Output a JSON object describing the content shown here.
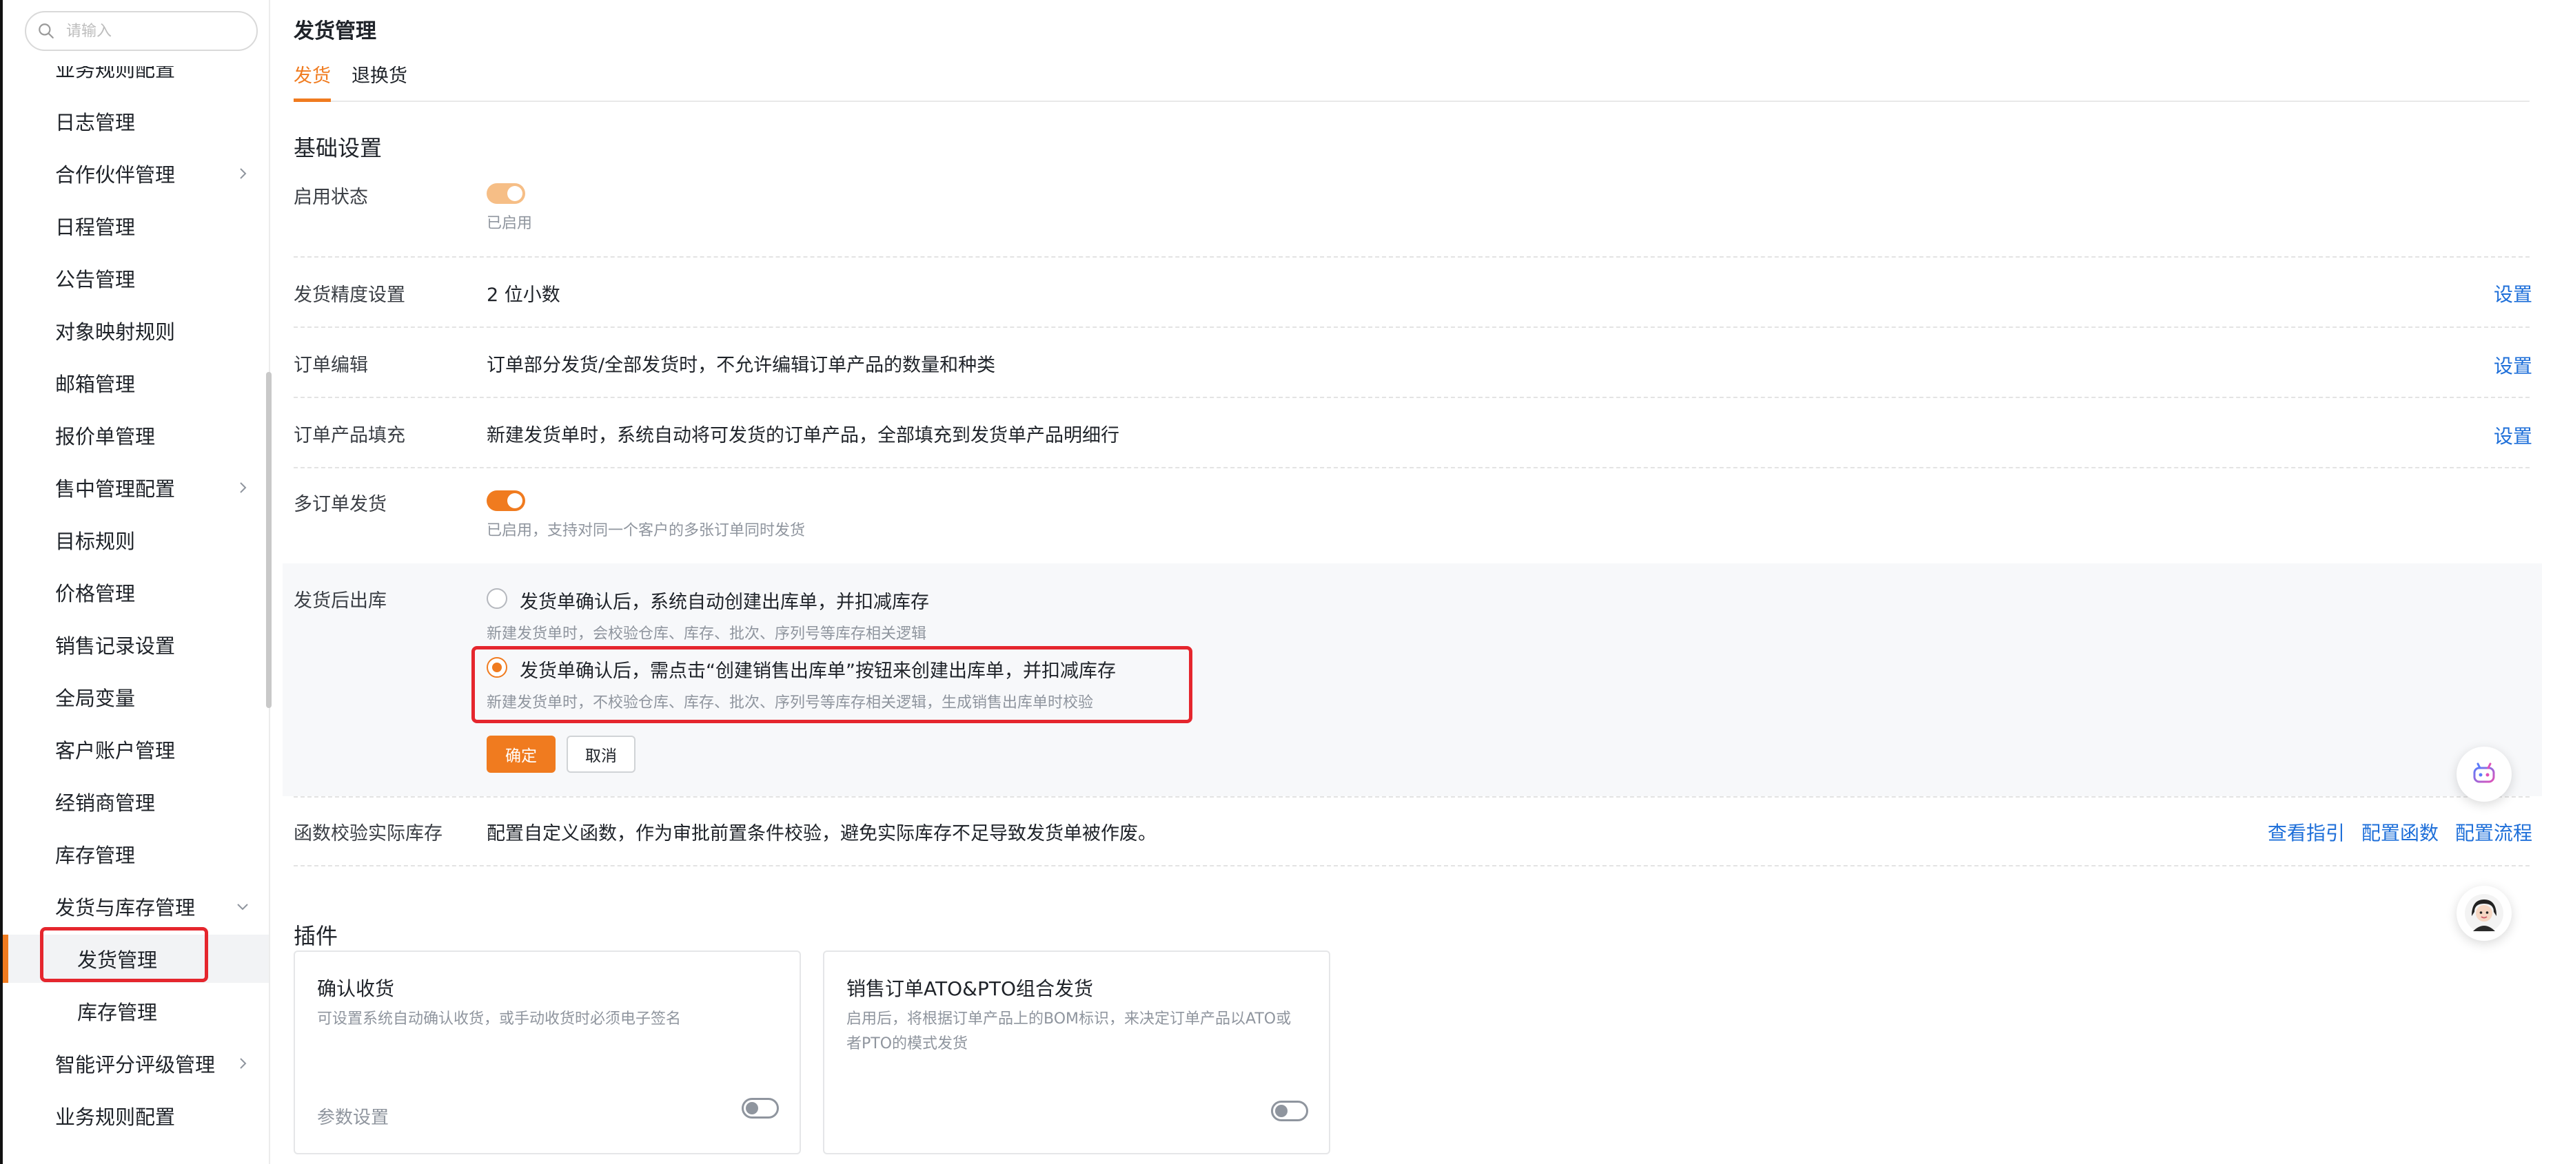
{
  "sidebar": {
    "search": {
      "placeholder": "请输入"
    },
    "partial_item": "业务规则配置",
    "items": [
      {
        "label": "日志管理"
      },
      {
        "label": "合作伙伴管理"
      },
      {
        "label": "日程管理"
      },
      {
        "label": "公告管理"
      },
      {
        "label": "对象映射规则"
      },
      {
        "label": "邮箱管理"
      },
      {
        "label": "报价单管理"
      },
      {
        "label": "售中管理配置"
      },
      {
        "label": "目标规则"
      },
      {
        "label": "价格管理"
      },
      {
        "label": "销售记录设置"
      },
      {
        "label": "全局变量"
      },
      {
        "label": "客户账户管理"
      },
      {
        "label": "经销商管理"
      },
      {
        "label": "库存管理"
      },
      {
        "label": "发货与库存管理"
      },
      {
        "label": "发货管理"
      },
      {
        "label": "库存管理"
      },
      {
        "label": "智能评分评级管理"
      },
      {
        "label": "业务规则配置"
      }
    ]
  },
  "main": {
    "title": "发货管理",
    "tabs": [
      {
        "label": "发货"
      },
      {
        "label": "退换货"
      }
    ],
    "basic_section": "基础设置",
    "rows": {
      "enable": {
        "label": "启用状态",
        "sub": "已启用"
      },
      "precision": {
        "label": "发货精度设置",
        "value": "2 位小数",
        "link": "设置"
      },
      "order_edit": {
        "label": "订单编辑",
        "value": "订单部分发货/全部发货时，不允许编辑订单产品的数量和种类",
        "link": "设置"
      },
      "order_fill": {
        "label": "订单产品填充",
        "value": "新建发货单时，系统自动将可发货的订单产品，全部填充到发货单产品明细行",
        "link": "设置"
      },
      "multi_order": {
        "label": "多订单发货",
        "sub": "已启用，支持对同一个客户的多张订单同时发货"
      },
      "after_ship": {
        "label": "发货后出库",
        "option1": "发货单确认后，系统自动创建出库单，并扣减库存",
        "option1_sub": "新建发货单时，会校验仓库、库存、批次、序列号等库存相关逻辑",
        "option2": "发货单确认后，需点击“创建销售出库单”按钮来创建出库单，并扣减库存",
        "option2_sub": "新建发货单时，不校验仓库、库存、批次、序列号等库存相关逻辑，生成销售出库单时校验",
        "confirm": "确定",
        "cancel": "取消"
      },
      "func_check": {
        "label": "函数校验实际库存",
        "value": "配置自定义函数，作为审批前置条件校验，避免实际库存不足导致发货单被作废。",
        "link1": "查看指引",
        "link2": "配置函数",
        "link3": "配置流程"
      }
    },
    "plugins_section": "插件",
    "plugins": [
      {
        "title": "确认收货",
        "desc": "可设置系统自动确认收货，或手动收货时必须电子签名",
        "setting": "参数设置",
        "enabled": false
      },
      {
        "title": "销售订单ATO&PTO组合发货",
        "desc": "启用后，将根据订单产品上的BOM标识，来决定订单产品以ATO或者PTO的模式发货",
        "enabled": false
      }
    ]
  },
  "colors": {
    "accent": "#f07b1f",
    "link": "#1e6fd9",
    "highlight": "#e5262d"
  },
  "icons": [
    "search-icon",
    "chevron-right-icon",
    "chevron-down-icon",
    "robot-assistant-icon",
    "avatar-icon"
  ]
}
